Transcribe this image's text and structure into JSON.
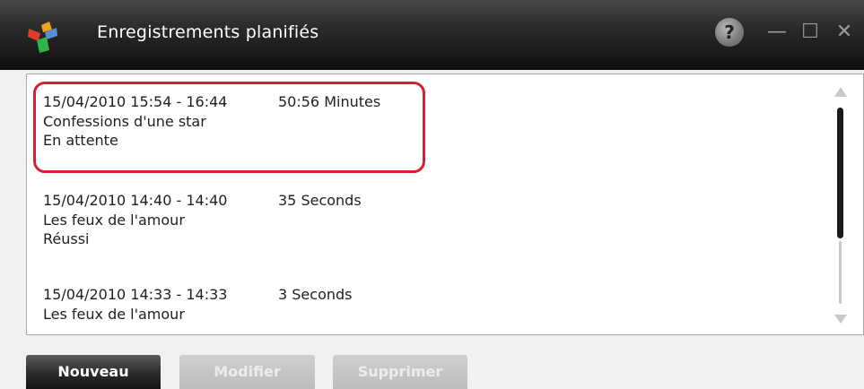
{
  "window": {
    "title": "Enregistrements planifiés",
    "help_glyph": "?",
    "minimize_glyph": "—",
    "maximize_glyph": "☐",
    "close_glyph": "✕",
    "logo_icon": "app-logo-icon"
  },
  "recordings": [
    {
      "time": "15/04/2010 15:54 - 16:44",
      "duration": "50:56 Minutes",
      "title": "Confessions d'une star",
      "status": "En attente",
      "highlighted": true
    },
    {
      "time": "15/04/2010 14:40 - 14:40",
      "duration": "35 Seconds",
      "title": "Les feux de l'amour",
      "status": "Réussi"
    },
    {
      "time": "15/04/2010 14:33 - 14:33",
      "duration": "3 Seconds",
      "title": "Les feux de l'amour"
    }
  ],
  "buttons": {
    "new_label": "Nouveau",
    "edit_label": "Modifier",
    "delete_label": "Supprimer"
  },
  "colors": {
    "highlight": "#d62032",
    "titlebar": "#1a1a1a"
  }
}
